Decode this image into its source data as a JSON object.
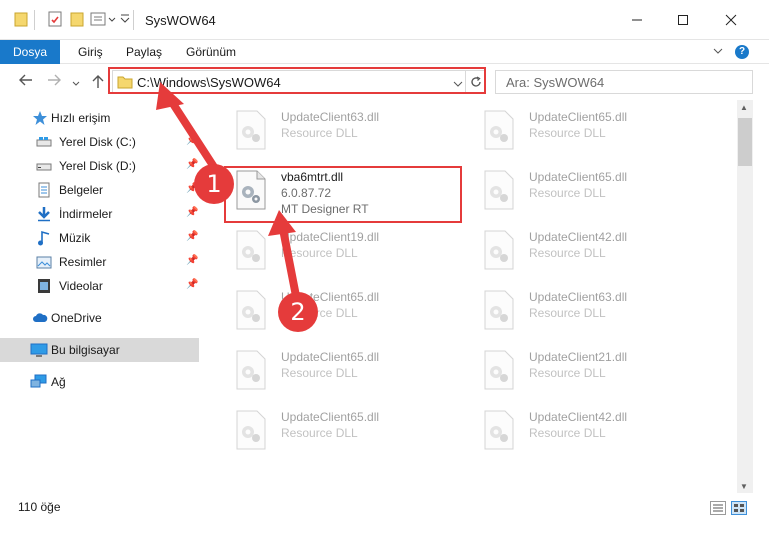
{
  "window": {
    "title": "SysWOW64",
    "controls": [
      "minimize",
      "maximize",
      "close"
    ]
  },
  "ribbon": {
    "tabs": [
      "Dosya",
      "Giriş",
      "Paylaş",
      "Görünüm"
    ],
    "help_label": "?"
  },
  "address": {
    "path": "C:\\Windows\\SysWOW64",
    "search_placeholder": "Ara: SysWOW64"
  },
  "sidebar": {
    "items": [
      {
        "label": "Hızlı erişim",
        "icon": "star-icon",
        "pinned": false
      },
      {
        "label": "Yerel Disk (C:)",
        "icon": "drive-icon",
        "pinned": true
      },
      {
        "label": "Yerel Disk (D:)",
        "icon": "drive-icon",
        "pinned": true
      },
      {
        "label": "Belgeler",
        "icon": "document-icon",
        "pinned": true
      },
      {
        "label": "İndirmeler",
        "icon": "download-icon",
        "pinned": true
      },
      {
        "label": "Müzik",
        "icon": "music-icon",
        "pinned": true
      },
      {
        "label": "Resimler",
        "icon": "pictures-icon",
        "pinned": true
      },
      {
        "label": "Videolar",
        "icon": "video-icon",
        "pinned": true
      },
      {
        "label": "OneDrive",
        "icon": "cloud-icon",
        "pinned": false
      },
      {
        "label": "Bu bilgisayar",
        "icon": "computer-icon",
        "pinned": false
      },
      {
        "label": "Ağ",
        "icon": "network-icon",
        "pinned": false
      }
    ]
  },
  "files": {
    "left_column": [
      {
        "name": "UpdateClient63.dll",
        "type": "Resource DLL"
      },
      {
        "name": "vba6mtrt.dll",
        "version": "6.0.87.72",
        "description": "MT Designer RT"
      },
      {
        "name": "UpdateClient19.dll",
        "type": "Resource DLL"
      },
      {
        "name": "UpdateClient65.dll",
        "type": "Resource DLL"
      },
      {
        "name": "UpdateClient65.dll",
        "type": "Resource DLL"
      },
      {
        "name": "UpdateClient65.dll",
        "type": "Resource DLL"
      }
    ],
    "right_column": [
      {
        "name": "UpdateClient65.dll",
        "type": "Resource DLL"
      },
      {
        "name": "UpdateClient65.dll",
        "type": "Resource DLL"
      },
      {
        "name": "UpdateClient42.dll",
        "type": "Resource DLL"
      },
      {
        "name": "UpdateClient63.dll",
        "type": "Resource DLL"
      },
      {
        "name": "UpdateClient21.dll",
        "type": "Resource DLL"
      },
      {
        "name": "UpdateClient42.dll",
        "type": "Resource DLL"
      }
    ]
  },
  "status": {
    "count": "110 öğe"
  },
  "annotations": {
    "step1": "1",
    "step2": "2",
    "color": "#e53b3b"
  }
}
